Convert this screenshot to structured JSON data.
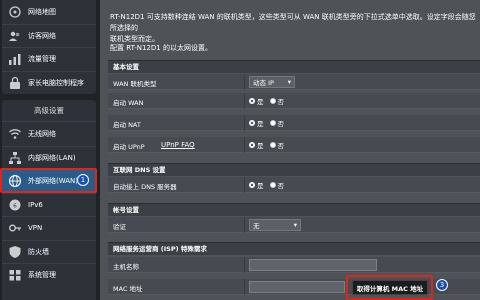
{
  "sidebar": {
    "top_items": [
      {
        "label": "网络地图",
        "icon": "network-map-icon"
      },
      {
        "label": "访客网络",
        "icon": "guest-network-icon"
      },
      {
        "label": "流量管理",
        "icon": "traffic-manager-icon"
      },
      {
        "label": "家长电脑控制程序",
        "icon": "parental-control-icon"
      }
    ],
    "advanced_header": "高级设置",
    "advanced_items": [
      {
        "label": "无线网络",
        "icon": "wireless-icon"
      },
      {
        "label": "内部网络(LAN)",
        "icon": "lan-icon"
      },
      {
        "label": "外部网络(WAN)",
        "icon": "wan-globe-icon"
      },
      {
        "label": "IPv6",
        "icon": "ipv6-icon"
      },
      {
        "label": "VPN",
        "icon": "vpn-icon"
      },
      {
        "label": "防火墙",
        "icon": "firewall-icon"
      },
      {
        "label": "系统管理",
        "icon": "administration-icon"
      }
    ]
  },
  "annotations": {
    "badge_1": "1",
    "badge_3": "3"
  },
  "intro": {
    "line1": "RT-N12D1 可支持数种连结 WAN 的联机类型，这些类型可从 WAN 联机类型旁的下拉式选单中选取。设定字段会随您所选择的",
    "line2": "联机类型而定。",
    "config_note": "配置 RT-N12D1 的以太网设置。"
  },
  "basic": {
    "header": "基本设置",
    "wan_type_label": "WAN 联机类型",
    "wan_type_value": "动态 IP",
    "enable_wan_label": "启动 WAN",
    "enable_nat_label": "启动 NAT",
    "enable_upnp_label": "启动 UPnP",
    "upnp_faq": "UPnP  FAQ"
  },
  "dns": {
    "header": "互联网 DNS 设置",
    "auto_dns_label": "自动接上 DNS 服务器"
  },
  "account": {
    "header": "帐号设置",
    "auth_label": "验证",
    "auth_value": "无"
  },
  "isp": {
    "header": "网络服务运营商 (ISP) 特殊需求",
    "host_label": "主机名称",
    "host_value": "",
    "mac_label": "MAC 地址",
    "mac_value": "",
    "clone_mac_button": "取得计算机 MAC 地址"
  },
  "radio_labels": {
    "yes": "是",
    "no": "否"
  },
  "dropdown_arrow": "▾",
  "colors": {
    "callout": "#e1251b",
    "badge": "#1a4fb8",
    "active_nav": "#2a5c8a"
  }
}
